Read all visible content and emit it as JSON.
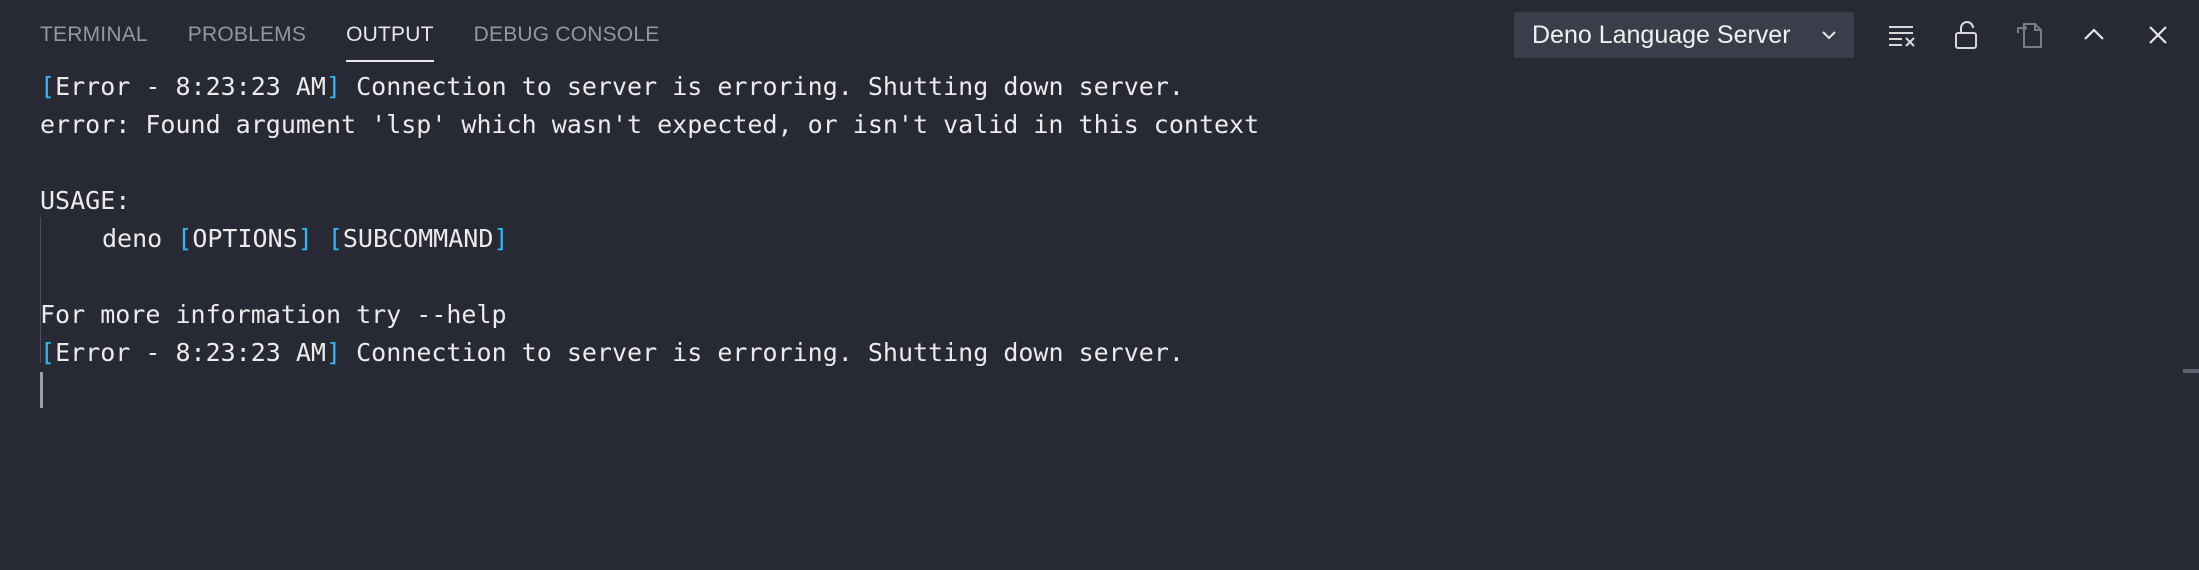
{
  "tabs": [
    {
      "label": "TERMINAL"
    },
    {
      "label": "PROBLEMS"
    },
    {
      "label": "OUTPUT"
    },
    {
      "label": "DEBUG CONSOLE"
    }
  ],
  "active_tab": "OUTPUT",
  "channel_select": {
    "value": "Deno Language Server"
  },
  "toolbar": {
    "icons": [
      "clear-output-icon",
      "lock-icon",
      "open-in-editor-icon",
      "maximize-panel-icon",
      "close-panel-icon"
    ]
  },
  "output": {
    "error1": {
      "bracket_open": "[",
      "text": "Error - 8:23:23 AM",
      "bracket_close": "]",
      "message": " Connection to server is erroring. Shutting down server."
    },
    "line2": "error: Found argument 'lsp' which wasn't expected, or isn't valid in this context",
    "usage": "USAGE:",
    "usage_cmd": {
      "prefix": "deno ",
      "open1": "[",
      "opt1": "OPTIONS",
      "close1": "]",
      "sep": " ",
      "open2": "[",
      "opt2": "SUBCOMMAND",
      "close2": "]"
    },
    "help": "For more information try --help",
    "error2": {
      "bracket_open": "[",
      "text": "Error - 8:23:23 AM",
      "bracket_close": "]",
      "message": " Connection to server is erroring. Shutting down server."
    }
  },
  "colors": {
    "background": "#272a35",
    "bracket": "#35b6f2",
    "active_tab": "#e8e8e8",
    "inactive_tab": "#9197a3"
  }
}
